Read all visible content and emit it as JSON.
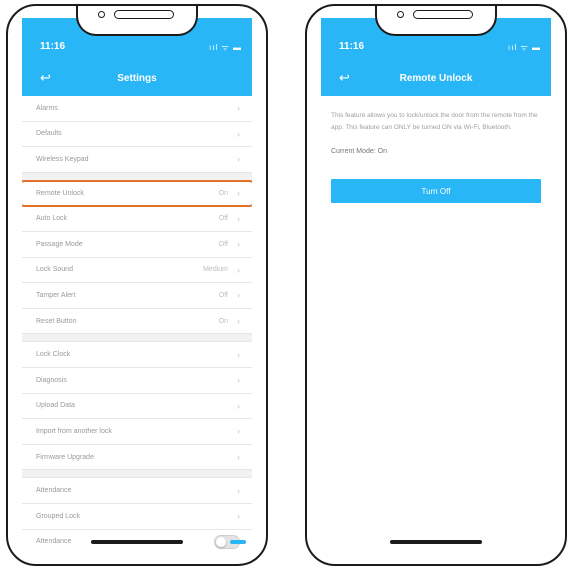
{
  "status": {
    "time": "11:16",
    "icons": "ııl ᯤ ▬"
  },
  "settings": {
    "title": "Settings",
    "groups": [
      [
        {
          "label": "Alarms",
          "value": ""
        },
        {
          "label": "Defaults",
          "value": ""
        },
        {
          "label": "Wireless Keypad",
          "value": ""
        }
      ],
      [
        {
          "label": "Remote Unlock",
          "value": "On",
          "highlighted": true
        },
        {
          "label": "Auto Lock",
          "value": "Off"
        },
        {
          "label": "Passage Mode",
          "value": "Off"
        },
        {
          "label": "Lock Sound",
          "value": "Medium"
        },
        {
          "label": "Tamper Alert",
          "value": "Off"
        },
        {
          "label": "Reset Button",
          "value": "On"
        }
      ],
      [
        {
          "label": "Lock Clock",
          "value": ""
        },
        {
          "label": "Diagnosis",
          "value": ""
        },
        {
          "label": "Upload Data",
          "value": ""
        },
        {
          "label": "Import from another lock",
          "value": ""
        },
        {
          "label": "Firmware Upgrade",
          "value": ""
        }
      ],
      [
        {
          "label": "Attendance",
          "value": ""
        },
        {
          "label": "Grouped Lock",
          "value": ""
        },
        {
          "label": "Attendance",
          "value": "",
          "toggle": true
        }
      ]
    ]
  },
  "remote": {
    "title": "Remote Unlock",
    "description": "This feature allows you to lock/unlock the door from the remote from the app. This feature can ONLY be turned ON via Wi-Fi, Bluetooth.",
    "mode_label": "Current Mode: On",
    "button_label": "Turn Off"
  },
  "colors": {
    "accent": "#29b6f6",
    "highlight": "#e2712b"
  }
}
